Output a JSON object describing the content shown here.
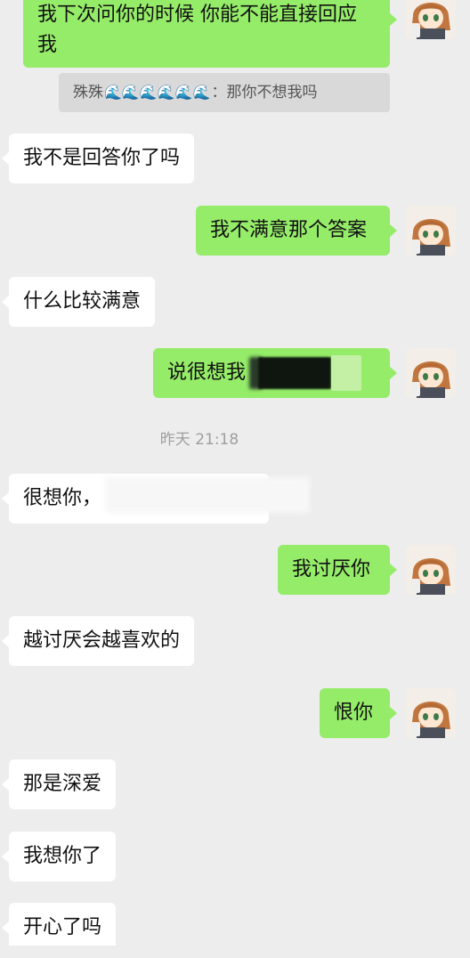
{
  "messages": {
    "m1": "我下次问你的时候 你能不能直接回应我",
    "quote_name": "殊殊",
    "quote_waves": "🌊🌊🌊🌊🌊🌊",
    "quote_sep": "：",
    "quote_text": "那你不想我吗",
    "m2": "我不是回答你了吗",
    "m3": "我不满意那个答案",
    "m4": "什么比较满意",
    "m5": "说很想我",
    "timestamp": "昨天 21:18",
    "m6": "很想你，",
    "m7": "我讨厌你",
    "m8": "越讨厌会越喜欢的",
    "m9": "恨你",
    "m10": "那是深爱",
    "m11": "我想你了",
    "m12": "开心了吗"
  },
  "colors": {
    "background": "#ededed",
    "outgoing_bubble": "#95ec69",
    "incoming_bubble": "#ffffff"
  },
  "icons": {
    "avatar": "anime-girl-avatar-icon"
  }
}
